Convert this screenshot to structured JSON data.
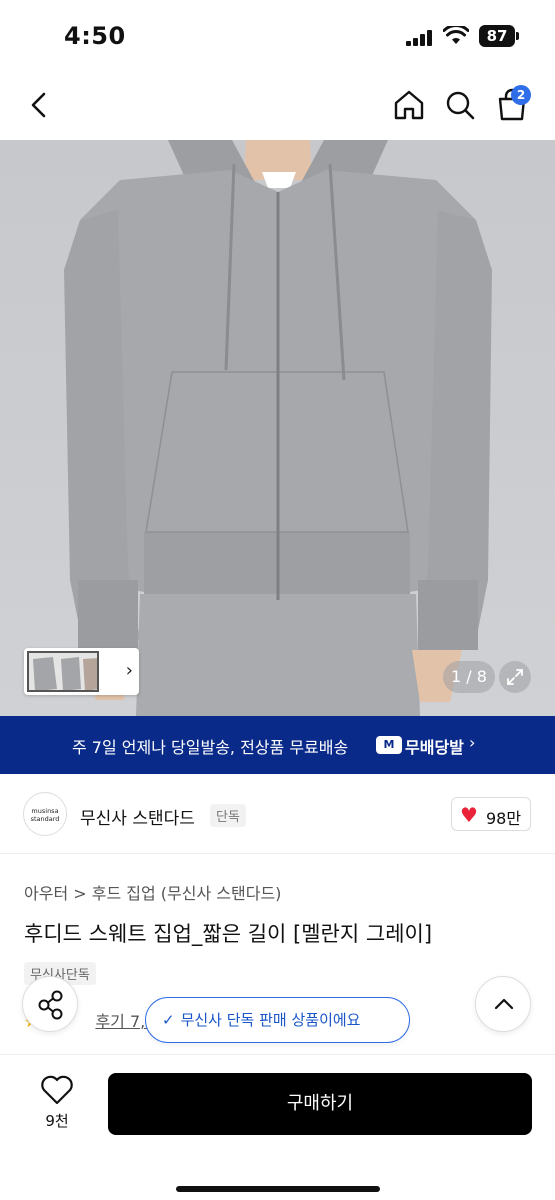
{
  "status_bar": {
    "time": "4:50",
    "battery": "87"
  },
  "header": {
    "cart_count": "2"
  },
  "gallery": {
    "counter": "1 / 8"
  },
  "shipping_banner": {
    "text": "주 7일 언제나 당일발송, 전상품 무료배송",
    "logo": "M",
    "brand": "무배당발",
    "chevron": "›"
  },
  "brand": {
    "logo_line1": "musinsa",
    "logo_line2": "standard",
    "name": "무신사 스탠다드",
    "tag": "단독",
    "like_count": "98만"
  },
  "product": {
    "breadcrumb": "아우터 > 후드 집업 (무신사 스탠다드)",
    "title": "후디드 스웨트 집업_짧은 길이 [멜란지 그레이]",
    "exclusive_tag": "무신사단독",
    "review_text": "후기 7,08"
  },
  "toast": {
    "check": "✓",
    "text": "무신사 단독 판매 상품이에요"
  },
  "bottom_bar": {
    "wish_count": "9천",
    "buy_label": "구매하기"
  },
  "colors": {
    "banner": "#0a2a8a",
    "accent": "#2f6ee8",
    "heart": "#e8233a",
    "buy": "#000000"
  }
}
